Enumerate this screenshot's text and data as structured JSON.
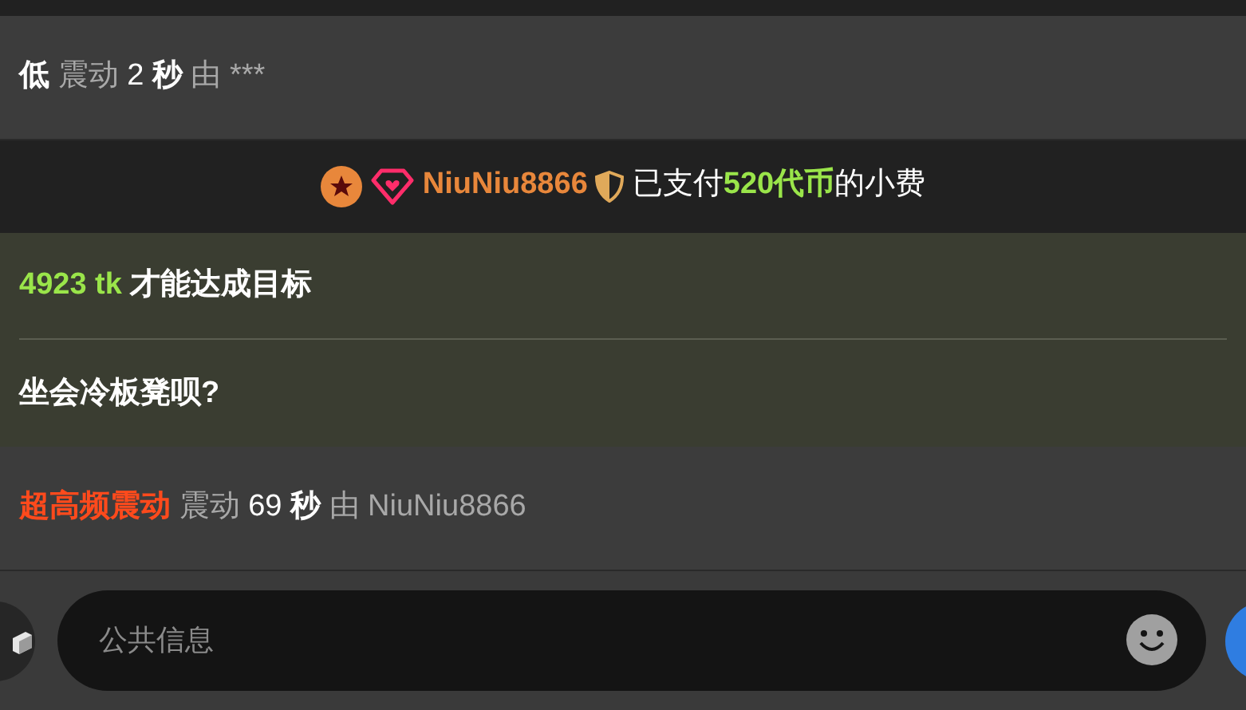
{
  "messages": [
    {
      "kind": "vibration",
      "parts": [
        {
          "kind": "bold",
          "text": "低"
        },
        {
          "kind": "dim",
          "text": "震动"
        },
        {
          "kind": "plain",
          "text": "2"
        },
        {
          "kind": "bold",
          "text": "秒"
        },
        {
          "kind": "dim",
          "text": "由"
        },
        {
          "kind": "dim",
          "text": "***"
        }
      ]
    },
    {
      "kind": "tip",
      "user": "NiuNiu8866",
      "parts": [
        {
          "kind": "plain",
          "text": "已支付"
        },
        {
          "kind": "green",
          "text": "520代币"
        },
        {
          "kind": "plain",
          "text": "的小费"
        }
      ]
    },
    {
      "kind": "goal",
      "lines": [
        {
          "parts": [
            {
              "kind": "green",
              "text": "4923 tk"
            },
            {
              "kind": "bold",
              "text": " 才能达成目标"
            }
          ]
        },
        {
          "parts": [
            {
              "kind": "bold",
              "text": "坐会冷板凳呗?"
            }
          ]
        }
      ]
    },
    {
      "kind": "vibration",
      "parts": [
        {
          "kind": "red",
          "text": "超高频震动"
        },
        {
          "kind": "dim",
          "text": "震动"
        },
        {
          "kind": "plain",
          "text": "69"
        },
        {
          "kind": "bold",
          "text": "秒"
        },
        {
          "kind": "dim",
          "text": "由"
        },
        {
          "kind": "dim",
          "text": "NiuNiu8866"
        }
      ]
    }
  ],
  "composer": {
    "placeholder": "公共信息"
  }
}
